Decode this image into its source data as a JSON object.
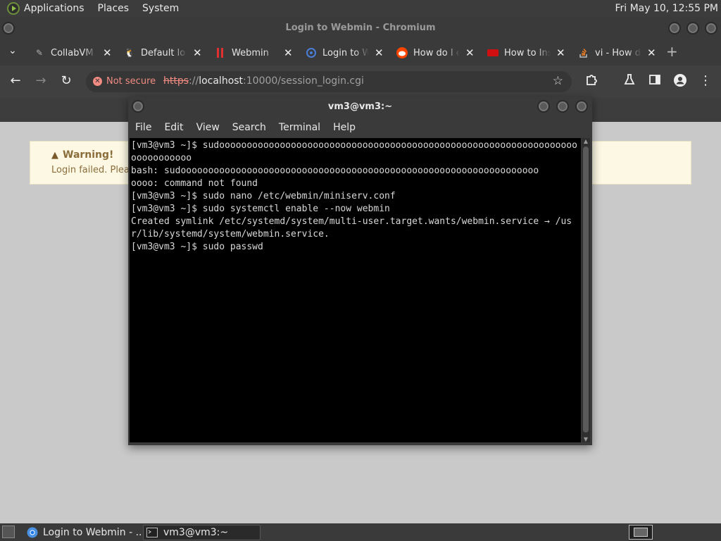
{
  "top_panel": {
    "menus": [
      "Applications",
      "Places",
      "System"
    ],
    "clock": "Fri May 10, 12:55 PM"
  },
  "browser": {
    "window_title": "Login to Webmin - Chromium",
    "tabs": [
      {
        "label": "CollabVM",
        "icon": "collabvm-icon",
        "color": "#b0b0b0"
      },
      {
        "label": "Default lo",
        "icon": "linux-tux-icon",
        "color": "#ffffff"
      },
      {
        "label": "Webmin",
        "icon": "webmin-icon",
        "color": "#e03030"
      },
      {
        "label": "Login to W",
        "icon": "virtualmin-icon",
        "color": "#4a7fd8"
      },
      {
        "label": "How do I e",
        "icon": "reddit-icon",
        "color": "#ff4500"
      },
      {
        "label": "How to Ins",
        "icon": "red-badge-icon",
        "color": "#d01010"
      },
      {
        "label": "vi - How d",
        "icon": "stackoverflow-icon",
        "color": "#f48024"
      }
    ],
    "toolbar": {
      "not_secure": "Not secure",
      "url_scheme": "https",
      "url_sep": "://",
      "url_host": "localhost",
      "url_path": ":10000/session_login.cgi"
    }
  },
  "page": {
    "warning_title": "Warning!",
    "warning_message": "Login failed. Please"
  },
  "terminal": {
    "title": "vm3@vm3:~",
    "menus": [
      "File",
      "Edit",
      "View",
      "Search",
      "Terminal",
      "Help"
    ],
    "lines": [
      "[vm3@vm3 ~]$ sudooooooooooooooooooooooooooooooooooooooooooooooooooooooooooooooooo",
      "ooooooooooo",
      "bash: sudooooooooooooooooooooooooooooooooooooooooooooooooooooooooooooooooo",
      "oooo: command not found",
      "[vm3@vm3 ~]$ sudo nano /etc/webmin/miniserv.conf",
      "[vm3@vm3 ~]$ sudo systemctl enable --now webmin",
      "Created symlink /etc/systemd/system/multi-user.target.wants/webmin.service → /us",
      "r/lib/systemd/system/webmin.service.",
      "[vm3@vm3 ~]$ sudo passwd"
    ]
  },
  "taskbar": {
    "items": [
      {
        "label": "Login to Webmin - ...",
        "icon": "chromium-icon"
      },
      {
        "label": "vm3@vm3:~",
        "icon": "terminal-icon"
      }
    ]
  }
}
